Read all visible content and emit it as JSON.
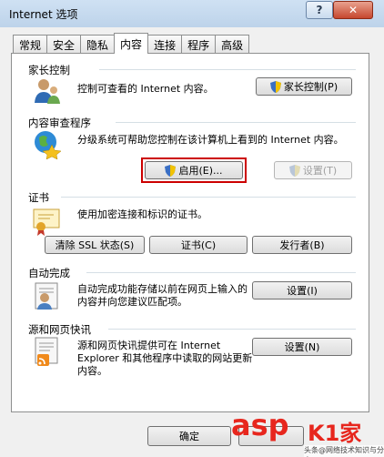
{
  "window": {
    "title": "Internet 选项",
    "help_symbol": "?",
    "close_symbol": "✕"
  },
  "tabs": [
    "常规",
    "安全",
    "隐私",
    "内容",
    "连接",
    "程序",
    "高级"
  ],
  "active_tab": "内容",
  "sections": {
    "parental": {
      "title": "家长控制",
      "desc": "控制可查看的 Internet 内容。",
      "button": "家长控制(P)"
    },
    "advisor": {
      "title": "内容审查程序",
      "desc": "分级系统可帮助您控制在该计算机上看到的 Internet 内容。",
      "enable_button": "启用(E)...",
      "settings_button": "设置(T)"
    },
    "certs": {
      "title": "证书",
      "desc": "使用加密连接和标识的证书。",
      "clear_ssl": "清除 SSL 状态(S)",
      "certs_button": "证书(C)",
      "publishers": "发行者(B)"
    },
    "autocomplete": {
      "title": "自动完成",
      "desc": "自动完成功能存储以前在网页上输入的内容并向您建议匹配项。",
      "settings_button": "设置(I)"
    },
    "feeds": {
      "title": "源和网页快讯",
      "desc": "源和网页快讯提供可在 Internet Explorer 和其他程序中读取的网站更新内容。",
      "settings_button": "设置(N)"
    }
  },
  "footer": {
    "ok": "确定"
  },
  "watermark": {
    "brand": "asp",
    "cn": "K1家",
    "sub": "头条@网络技术知识与分享"
  }
}
